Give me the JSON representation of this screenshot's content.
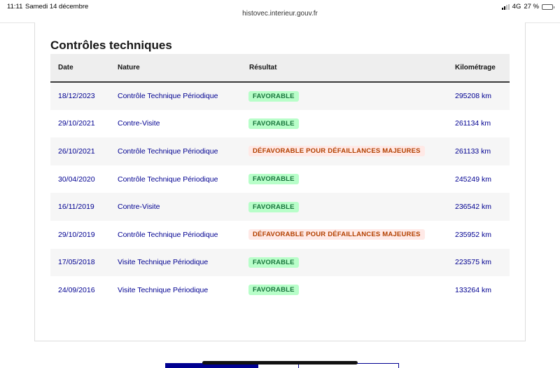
{
  "status_bar": {
    "time": "11:11",
    "date": "Samedi 14 décembre",
    "network": "4G",
    "battery_percent": "27 %",
    "battery_level": 0.27
  },
  "browser": {
    "url": "histovec.interieur.gouv.fr"
  },
  "section": {
    "title": "Contrôles techniques"
  },
  "table": {
    "headers": {
      "date": "Date",
      "nature": "Nature",
      "result": "Résultat",
      "km": "Kilométrage"
    },
    "rows": [
      {
        "date": "18/12/2023",
        "nature": "Contrôle Technique Périodique",
        "result": "FAVORABLE",
        "status": "ok",
        "km": "295208 km"
      },
      {
        "date": "29/10/2021",
        "nature": "Contre-Visite",
        "result": "FAVORABLE",
        "status": "ok",
        "km": "261134 km"
      },
      {
        "date": "26/10/2021",
        "nature": "Contrôle Technique Périodique",
        "result": "DÉFAVORABLE POUR DÉFAILLANCES MAJEURES",
        "status": "ko",
        "km": "261133 km"
      },
      {
        "date": "30/04/2020",
        "nature": "Contrôle Technique Périodique",
        "result": "FAVORABLE",
        "status": "ok",
        "km": "245249 km"
      },
      {
        "date": "16/11/2019",
        "nature": "Contre-Visite",
        "result": "FAVORABLE",
        "status": "ok",
        "km": "236542 km"
      },
      {
        "date": "29/10/2019",
        "nature": "Contrôle Technique Périodique",
        "result": "DÉFAVORABLE POUR DÉFAILLANCES MAJEURES",
        "status": "ko",
        "km": "235952 km"
      },
      {
        "date": "17/05/2018",
        "nature": "Visite Technique Périodique",
        "result": "FAVORABLE",
        "status": "ok",
        "km": "223575 km"
      },
      {
        "date": "24/09/2016",
        "nature": "Visite Technique Périodique",
        "result": "FAVORABLE",
        "status": "ok",
        "km": "133264 km"
      }
    ]
  },
  "colors": {
    "link_blue": "#000091",
    "favorable_bg": "#b8fec9",
    "favorable_text": "#18753c",
    "defavorable_bg": "#ffe9e6",
    "defavorable_text": "#b34000"
  }
}
